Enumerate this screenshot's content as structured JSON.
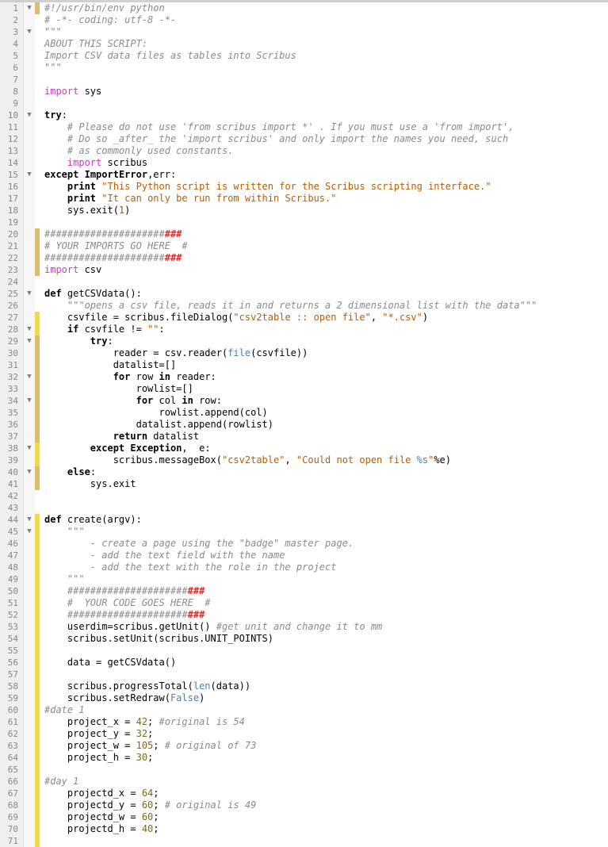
{
  "lines": [
    {
      "n": 1,
      "fold": "v",
      "ch": "cm",
      "html": "<span class='tok-comment'>#!/usr/bin/env python</span>"
    },
    {
      "n": 2,
      "fold": "",
      "ch": "",
      "html": "<span class='tok-comment'># -*- coding: utf-8 -*-</span>"
    },
    {
      "n": 3,
      "fold": "v",
      "ch": "",
      "html": "<span class='tok-docstr'>\"\"\"</span>"
    },
    {
      "n": 4,
      "fold": "",
      "ch": "",
      "html": "<span class='tok-docstr'>ABOUT THIS SCRIPT:</span>"
    },
    {
      "n": 5,
      "fold": "",
      "ch": "",
      "html": "<span class='tok-docstr'>Import CSV data files as tables into Scribus</span>"
    },
    {
      "n": 6,
      "fold": "",
      "ch": "",
      "html": "<span class='tok-docstr'>\"\"\"</span>"
    },
    {
      "n": 7,
      "fold": "",
      "ch": "",
      "html": ""
    },
    {
      "n": 8,
      "fold": "",
      "ch": "",
      "html": "<span class='tok-import'>import</span> sys"
    },
    {
      "n": 9,
      "fold": "",
      "ch": "",
      "html": ""
    },
    {
      "n": 10,
      "fold": "v",
      "ch": "",
      "html": "<span class='tok-keyword'>try</span>:"
    },
    {
      "n": 11,
      "fold": "",
      "ch": "",
      "html": "    <span class='tok-comment'># Please do not use 'from scribus import *' . If you must use a 'from import',</span>"
    },
    {
      "n": 12,
      "fold": "",
      "ch": "",
      "html": "    <span class='tok-comment'># Do so _after_ the 'import scribus' and only import the names you need, such</span>"
    },
    {
      "n": 13,
      "fold": "",
      "ch": "",
      "html": "    <span class='tok-comment'># as commonly used constants.</span>"
    },
    {
      "n": 14,
      "fold": "",
      "ch": "",
      "html": "    <span class='tok-import'>import</span> scribus"
    },
    {
      "n": 15,
      "fold": "v",
      "ch": "",
      "html": "<span class='tok-keyword'>except</span> <span class='tok-exc'>ImportError</span>,err:"
    },
    {
      "n": 16,
      "fold": "",
      "ch": "",
      "html": "    <span class='tok-keyword'>print</span> <span class='tok-string'>\"This Python script is written for the Scribus scripting interface.\"</span>"
    },
    {
      "n": 17,
      "fold": "",
      "ch": "",
      "html": "    <span class='tok-keyword'>print</span> <span class='tok-string'>\"It can only be run from within Scribus.\"</span>"
    },
    {
      "n": 18,
      "fold": "",
      "ch": "",
      "html": "    sys.exit(<span class='tok-number'>1</span>)"
    },
    {
      "n": 19,
      "fold": "",
      "ch": "",
      "html": ""
    },
    {
      "n": 20,
      "fold": "",
      "ch": "cm",
      "html": "<span class='tok-hashgrey'>#####################</span><span class='tok-hashred'>###</span>"
    },
    {
      "n": 21,
      "fold": "",
      "ch": "cm",
      "html": "<span class='tok-comment'># YOUR IMPORTS GO HERE  #</span>"
    },
    {
      "n": 22,
      "fold": "",
      "ch": "cm",
      "html": "<span class='tok-hashgrey'>#####################</span><span class='tok-hashred'>###</span>"
    },
    {
      "n": 23,
      "fold": "",
      "ch": "cm",
      "html": "<span class='tok-import'>import</span> csv"
    },
    {
      "n": 24,
      "fold": "",
      "ch": "",
      "html": ""
    },
    {
      "n": 25,
      "fold": "v",
      "ch": "",
      "html": "<span class='tok-keyword'>def</span> getCSVdata():"
    },
    {
      "n": 26,
      "fold": "",
      "ch": "",
      "html": "    <span class='tok-docstr'>\"\"\"opens a csv file, reads it in and returns a 2 dimensional list with the data\"\"\"</span>"
    },
    {
      "n": 27,
      "fold": "",
      "ch": "cy",
      "html": "    csvfile = scribus.fileDialog(<span class='tok-string'>\"csv2table :: open file\"</span>, <span class='tok-string'>\"*.csv\"</span>)"
    },
    {
      "n": 28,
      "fold": "v",
      "ch": "cy",
      "html": "    <span class='tok-keyword'>if</span> csvfile != <span class='tok-string'>\"\"</span>:"
    },
    {
      "n": 29,
      "fold": "v",
      "ch": "cm",
      "html": "        <span class='tok-keyword'>try</span>:"
    },
    {
      "n": 30,
      "fold": "",
      "ch": "cm",
      "html": "            reader = csv.reader(<span class='tok-builtin'>file</span>(csvfile))"
    },
    {
      "n": 31,
      "fold": "",
      "ch": "cm",
      "html": "            datalist=[]"
    },
    {
      "n": 32,
      "fold": "v",
      "ch": "cm",
      "html": "            <span class='tok-keyword'>for</span> row <span class='tok-keyword'>in</span> reader:"
    },
    {
      "n": 33,
      "fold": "",
      "ch": "cm",
      "html": "                rowlist=[]"
    },
    {
      "n": 34,
      "fold": "v",
      "ch": "cm",
      "html": "                <span class='tok-keyword'>for</span> col <span class='tok-keyword'>in</span> row:"
    },
    {
      "n": 35,
      "fold": "",
      "ch": "cm",
      "html": "                    rowlist.append(col)"
    },
    {
      "n": 36,
      "fold": "",
      "ch": "cm",
      "html": "                datalist.append(rowlist)"
    },
    {
      "n": 37,
      "fold": "",
      "ch": "cm",
      "html": "            <span class='tok-keyword'>return</span> datalist"
    },
    {
      "n": 38,
      "fold": "v",
      "ch": "cy",
      "html": "        <span class='tok-keyword'>except</span> <span class='tok-exc'>Exception</span>,  e:"
    },
    {
      "n": 39,
      "fold": "",
      "ch": "cy",
      "html": "            scribus.messageBox(<span class='tok-string'>\"csv2table\"</span>, <span class='tok-string'>\"Could not open file </span><span class='tok-builtin'>%s</span><span class='tok-string'>\"</span>%e)"
    },
    {
      "n": 40,
      "fold": "v",
      "ch": "cm",
      "html": "    <span class='tok-keyword'>else</span>:"
    },
    {
      "n": 41,
      "fold": "",
      "ch": "cm",
      "html": "        sys.exit"
    },
    {
      "n": 42,
      "fold": "",
      "ch": "",
      "html": ""
    },
    {
      "n": 43,
      "fold": "",
      "ch": "",
      "html": ""
    },
    {
      "n": 44,
      "fold": "v",
      "ch": "cy",
      "html": "<span class='tok-keyword'>def</span> create(argv):"
    },
    {
      "n": 45,
      "fold": "v",
      "ch": "cy",
      "html": "    <span class='tok-docstr'>\"\"\"</span>"
    },
    {
      "n": 46,
      "fold": "",
      "ch": "cy",
      "html": "<span class='tok-docstr'>        - create a page using the \"badge\" master page.</span>"
    },
    {
      "n": 47,
      "fold": "",
      "ch": "cy",
      "html": "<span class='tok-docstr'>        - add the text field with the name</span>"
    },
    {
      "n": 48,
      "fold": "",
      "ch": "cy",
      "html": "<span class='tok-docstr'>        - add the text with the role in the project</span>"
    },
    {
      "n": 49,
      "fold": "",
      "ch": "cy",
      "html": "<span class='tok-docstr'>    \"\"\"</span>"
    },
    {
      "n": 50,
      "fold": "",
      "ch": "cy",
      "html": "    <span class='tok-hashgrey'>#####################</span><span class='tok-hashred'>###</span>"
    },
    {
      "n": 51,
      "fold": "",
      "ch": "cy",
      "html": "    <span class='tok-comment'>#  YOUR CODE GOES HERE  #</span>"
    },
    {
      "n": 52,
      "fold": "",
      "ch": "cy",
      "html": "    <span class='tok-hashgrey'>#####################</span><span class='tok-hashred'>###</span>"
    },
    {
      "n": 53,
      "fold": "",
      "ch": "cy",
      "html": "    userdim=scribus.getUnit() <span class='tok-comment'>#get unit and change it to mm</span>"
    },
    {
      "n": 54,
      "fold": "",
      "ch": "cy",
      "html": "    scribus.setUnit(scribus.UNIT_POINTS)"
    },
    {
      "n": 55,
      "fold": "",
      "ch": "cy",
      "html": ""
    },
    {
      "n": 56,
      "fold": "",
      "ch": "cy",
      "html": "    data = getCSVdata()"
    },
    {
      "n": 57,
      "fold": "",
      "ch": "cy",
      "html": ""
    },
    {
      "n": 58,
      "fold": "",
      "ch": "cy",
      "html": "    scribus.progressTotal(<span class='tok-builtin'>len</span>(data))"
    },
    {
      "n": 59,
      "fold": "",
      "ch": "cy",
      "html": "    scribus.setRedraw(<span class='tok-builtin'>False</span>)"
    },
    {
      "n": 60,
      "fold": "",
      "ch": "cy",
      "html": "<span class='tok-comment'>#date 1</span>"
    },
    {
      "n": 61,
      "fold": "",
      "ch": "cy",
      "html": "    project_x = <span class='tok-number'>42</span>; <span class='tok-comment'>#original is 54</span>"
    },
    {
      "n": 62,
      "fold": "",
      "ch": "cy",
      "html": "    project_y = <span class='tok-number'>32</span>;"
    },
    {
      "n": 63,
      "fold": "",
      "ch": "cy",
      "html": "    project_w = <span class='tok-number'>105</span>; <span class='tok-comment'># original of 73</span>"
    },
    {
      "n": 64,
      "fold": "",
      "ch": "cy",
      "html": "    project_h = <span class='tok-number'>30</span>;"
    },
    {
      "n": 65,
      "fold": "",
      "ch": "cy",
      "html": ""
    },
    {
      "n": 66,
      "fold": "",
      "ch": "cy",
      "html": "<span class='tok-comment'>#day 1</span>"
    },
    {
      "n": 67,
      "fold": "",
      "ch": "cy",
      "html": "    projectd_x = <span class='tok-number'>64</span>;"
    },
    {
      "n": 68,
      "fold": "",
      "ch": "cy",
      "html": "    projectd_y = <span class='tok-number'>60</span>; <span class='tok-comment'># original is 49</span>"
    },
    {
      "n": 69,
      "fold": "",
      "ch": "cy",
      "html": "    projectd_w = <span class='tok-number'>60</span>;"
    },
    {
      "n": 70,
      "fold": "",
      "ch": "cy",
      "html": "    projectd_h = <span class='tok-number'>40</span>;"
    },
    {
      "n": 71,
      "fold": "",
      "ch": "cy",
      "html": ""
    }
  ]
}
